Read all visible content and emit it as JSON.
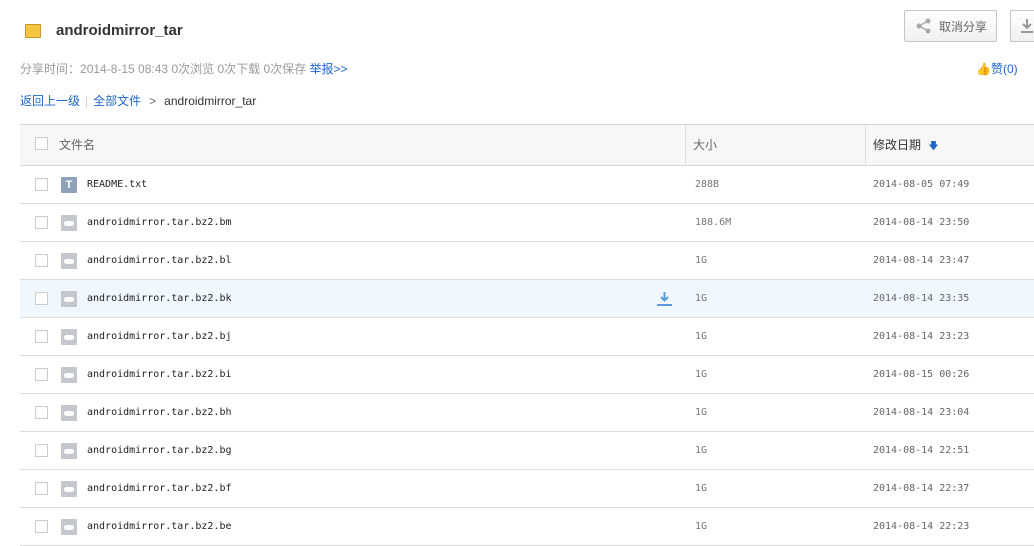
{
  "header": {
    "title": "androidmirror_tar",
    "meta_label": "分享时间：",
    "share_time": "2014-8-15 08:43",
    "views": "0次浏览",
    "downloads": "0次下载",
    "saves": "0次保存",
    "report": "举报>>",
    "cancel_share": "取消分享",
    "like": "赞(0)"
  },
  "breadcrumb": {
    "back": "返回上一级",
    "all": "全部文件",
    "current": "androidmirror_tar"
  },
  "table": {
    "columns": {
      "name": "文件名",
      "size": "大小",
      "date": "修改日期"
    },
    "rows": [
      {
        "name": "README.txt",
        "size": "288B",
        "date": "2014-08-05 07:49",
        "type": "txt"
      },
      {
        "name": "androidmirror.tar.bz2.bm",
        "size": "188.6M",
        "date": "2014-08-14 23:50",
        "type": "file"
      },
      {
        "name": "androidmirror.tar.bz2.bl",
        "size": "1G",
        "date": "2014-08-14 23:47",
        "type": "file"
      },
      {
        "name": "androidmirror.tar.bz2.bk",
        "size": "1G",
        "date": "2014-08-14 23:35",
        "type": "file"
      },
      {
        "name": "androidmirror.tar.bz2.bj",
        "size": "1G",
        "date": "2014-08-14 23:23",
        "type": "file"
      },
      {
        "name": "androidmirror.tar.bz2.bi",
        "size": "1G",
        "date": "2014-08-15 00:26",
        "type": "file"
      },
      {
        "name": "androidmirror.tar.bz2.bh",
        "size": "1G",
        "date": "2014-08-14 23:04",
        "type": "file"
      },
      {
        "name": "androidmirror.tar.bz2.bg",
        "size": "1G",
        "date": "2014-08-14 22:51",
        "type": "file"
      },
      {
        "name": "androidmirror.tar.bz2.bf",
        "size": "1G",
        "date": "2014-08-14 22:37",
        "type": "file"
      },
      {
        "name": "androidmirror.tar.bz2.be",
        "size": "1G",
        "date": "2014-08-14 22:23",
        "type": "file"
      }
    ]
  }
}
